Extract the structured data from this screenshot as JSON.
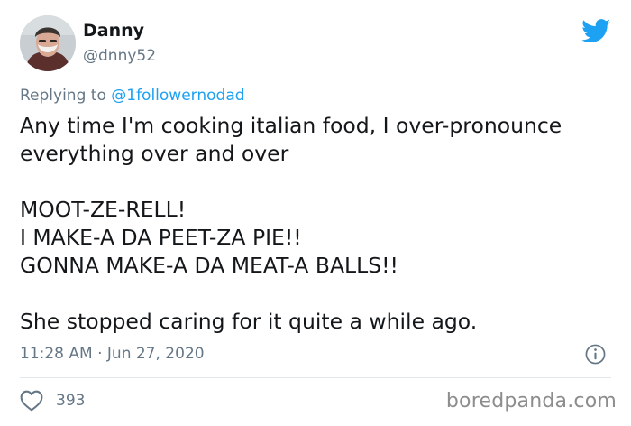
{
  "user": {
    "display_name": "Danny",
    "handle": "@dnny52",
    "avatar": "avatar-photo"
  },
  "reply": {
    "prefix": "Replying to ",
    "mention": "@1followernodad"
  },
  "tweet": {
    "paragraphs": [
      "Any time I'm cooking italian food, I over-pronounce everything over and over",
      "MOOT-ZE-RELL!\nI MAKE-A DA PEET-ZA PIE!!\nGONNA MAKE-A DA MEAT-A BALLS!!",
      "She stopped caring for it quite a while ago."
    ],
    "timestamp": "11:28 AM · Jun 27, 2020"
  },
  "actions": {
    "likes": "393"
  },
  "watermark": "boredpanda.com",
  "icons": {
    "brand": "twitter-bird-icon",
    "info": "info-icon",
    "like": "heart-icon"
  },
  "colors": {
    "twitter_blue": "#1da1f2",
    "secondary_text": "#657786",
    "primary_text": "#14171a",
    "divider": "#e1e8ed"
  }
}
